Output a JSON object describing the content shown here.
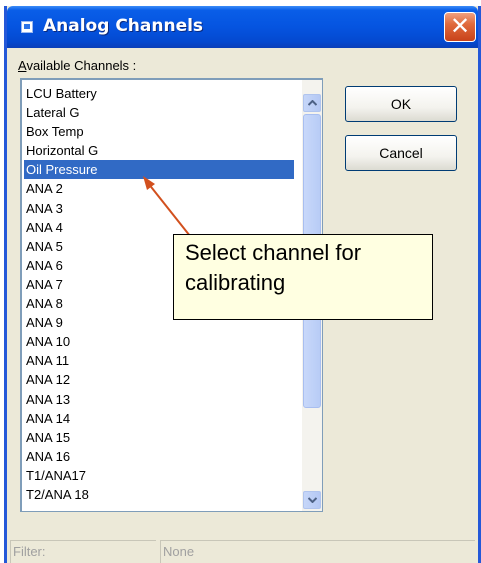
{
  "window": {
    "title": "Analog Channels",
    "close_label": "✕"
  },
  "channels": {
    "label_accesskey": "A",
    "label_rest": "vailable Channels :",
    "items": [
      "LCU Battery",
      "Lateral G",
      "Box Temp",
      "Horizontal G",
      "Oil Pressure",
      "ANA 2",
      "ANA 3",
      "ANA 4",
      "ANA 5",
      "ANA 6",
      "ANA 7",
      "ANA 8",
      "ANA 9",
      "ANA 10",
      "ANA 11",
      "ANA 12",
      "ANA 13",
      "ANA 14",
      "ANA 15",
      "ANA 16",
      "T1/ANA17",
      "T2/ANA 18"
    ],
    "selected": "Oil Pressure"
  },
  "buttons": {
    "ok": "OK",
    "cancel": "Cancel"
  },
  "callout": {
    "line1": "Select channel for",
    "line2": "calibrating"
  },
  "status": {
    "filter_label": "Filter:",
    "filter_value": "None"
  },
  "colors": {
    "selection": "#316ac5",
    "callout_bg": "#ffffe1",
    "arrow": "#d2501e",
    "titlebar": "#0554e0"
  }
}
